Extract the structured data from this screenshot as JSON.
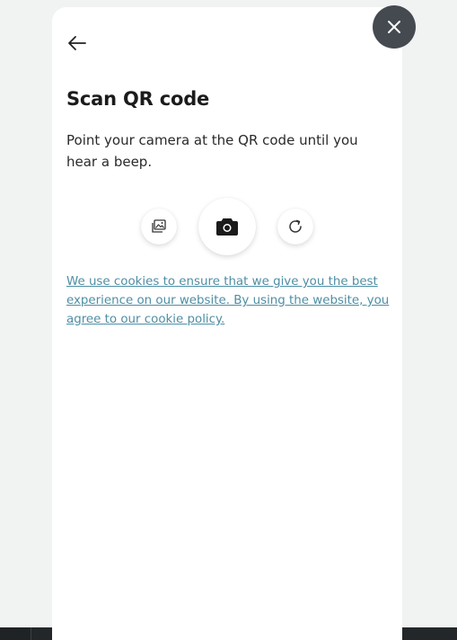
{
  "dialog": {
    "title": "Scan QR code",
    "description": "Point your camera at the QR code until you hear a beep.",
    "cookie_notice": "We use cookies to ensure that we give you the best experience on our website. By using the website, you agree to our cookie policy."
  },
  "icons": {
    "close": "close-icon",
    "back": "arrow-left-icon",
    "gallery": "image-gallery-icon",
    "camera": "camera-icon",
    "refresh": "refresh-icon"
  },
  "colors": {
    "page_background": "#f1f2f2",
    "modal_background": "#ffffff",
    "close_button": "#454a51",
    "link": "#4e8ea4",
    "title_text": "#1b1b1b",
    "bottom_bar": "#23272a"
  }
}
